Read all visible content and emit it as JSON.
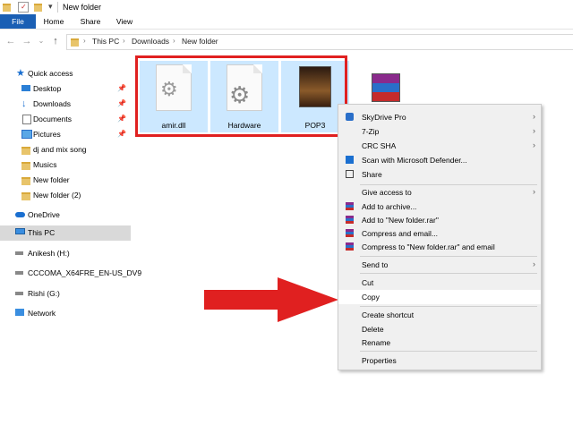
{
  "window": {
    "title": "New folder"
  },
  "ribbon": {
    "tabs": [
      "File",
      "Home",
      "Share",
      "View"
    ]
  },
  "address": {
    "crumbs": [
      "This PC",
      "Downloads",
      "New folder"
    ]
  },
  "sidebar": {
    "items": [
      {
        "label": "Quick access"
      },
      {
        "label": "Desktop"
      },
      {
        "label": "Downloads"
      },
      {
        "label": "Documents"
      },
      {
        "label": "Pictures"
      },
      {
        "label": "dj and mix song"
      },
      {
        "label": "Musics"
      },
      {
        "label": "New folder"
      },
      {
        "label": "New folder (2)"
      },
      {
        "label": "OneDrive"
      },
      {
        "label": "This PC"
      },
      {
        "label": "Anikesh (H:)"
      },
      {
        "label": "CCCOMA_X64FRE_EN-US_DV9"
      },
      {
        "label": "Rishi (G:)"
      },
      {
        "label": "Network"
      }
    ]
  },
  "files": [
    {
      "name": "amir.dll",
      "icon": "dll-gear-icon"
    },
    {
      "name": "Hardware",
      "icon": "system-file-icon"
    },
    {
      "name": "POP3",
      "icon": "game-image-icon"
    },
    {
      "name": "",
      "icon": "winrar-archive-icon"
    }
  ],
  "context_menu": {
    "items": [
      "SkyDrive Pro",
      "7-Zip",
      "CRC SHA",
      "Scan with Microsoft Defender...",
      "Share",
      "Give access to",
      "Add to archive...",
      "Add to \"New folder.rar\"",
      "Compress and email...",
      "Compress to \"New folder.rar\" and email",
      "Send to",
      "Cut",
      "Copy",
      "Create shortcut",
      "Delete",
      "Rename",
      "Properties"
    ]
  },
  "colors": {
    "accent": "#1a5fb4",
    "selection": "#cce8ff",
    "highlight_red": "#e02020"
  }
}
